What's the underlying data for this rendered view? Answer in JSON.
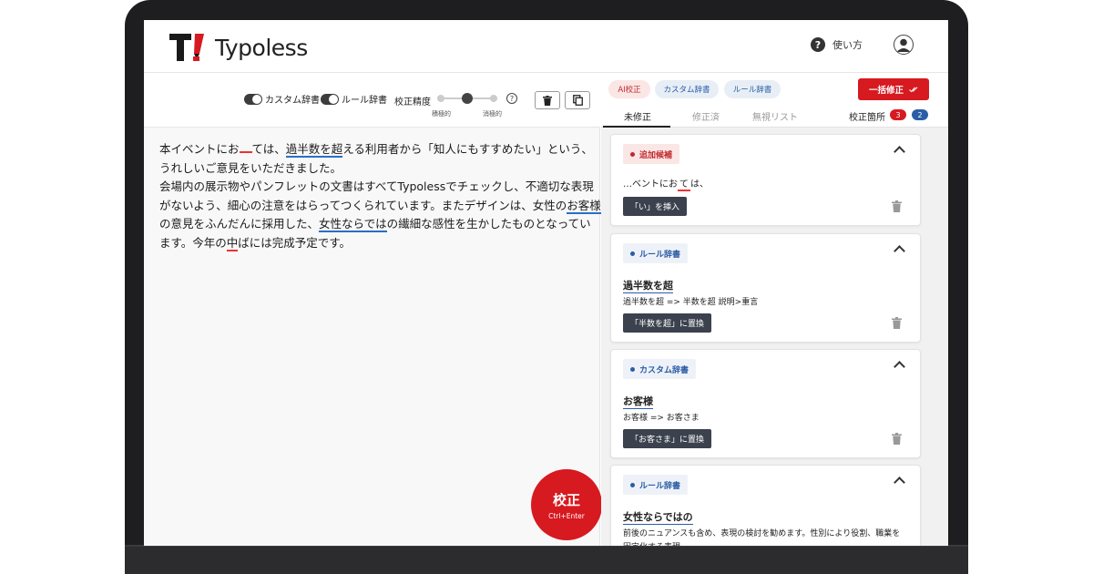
{
  "app": {
    "name": "Typoless"
  },
  "header": {
    "help_label": "使い方"
  },
  "toolbar": {
    "custom_dict_label": "カスタム辞書",
    "rule_dict_label": "ルール辞書",
    "precision_label": "校正精度",
    "precision_low": "積極的",
    "precision_high": "消極的",
    "precision_level": 2,
    "precision_steps": 3
  },
  "editor": {
    "line1_a": "本イベントにお",
    "line1_b": "ては、",
    "line1_c": "過半数を超",
    "line1_d": "える利用者から「知人にもすすめたい」という、",
    "line2": "うれしいご意見をいただきました。",
    "line3": "会場内の展示物やパンフレットの文書はすべてTypolessでチェックし、不適切な表現",
    "line4_a": "がないよう、細心の注意をはらってつくられています。またデザインは、女性の",
    "line4_b": "お客様",
    "line5_a": "の意見をふんだんに採用した、",
    "line5_b": "女性ならでは",
    "line5_c": "の繊細な感性を生かしたものとなってい",
    "line6_a": "ます。今年の",
    "line6_b": "中",
    "line6_c": "ばには完成予定です。"
  },
  "submit": {
    "label": "校正",
    "shortcut": "Ctrl+Enter"
  },
  "panel": {
    "filters": [
      "AI校正",
      "カスタム辞書",
      "ルール辞書"
    ],
    "fix_all_label": "一括修正",
    "tabs": [
      "未修正",
      "修正済",
      "無視リスト"
    ],
    "count_label": "校正箇所",
    "count_red": "3",
    "count_blue": "2"
  },
  "cards": [
    {
      "tag": "追加候補",
      "context": "…ベントにお",
      "context_gap": "て",
      "context_end": "は、",
      "button": "「い」を挿入"
    },
    {
      "tag": "ルール辞書",
      "title": "過半数を超",
      "desc": "過半数を超 => 半数を超 説明>重言",
      "button": "「半数を超」に置換"
    },
    {
      "tag": "カスタム辞書",
      "title": "お客様",
      "desc": "お客様 => お客さま",
      "button": "「お客さま」に置換"
    },
    {
      "tag": "ルール辞書",
      "title": "女性ならではの",
      "desc": "前後のニュアンスも含め、表現の検討を勧めます。性別により役割、職業を固定化する表現"
    }
  ],
  "colors": {
    "accent_red": "#d71920",
    "accent_blue": "#2a5da6",
    "dark_button": "#3b414d"
  },
  "icons": [
    "logo-icon",
    "help-icon",
    "user-icon",
    "trash-icon",
    "copy-icon",
    "chevron-up-icon",
    "check-icon",
    "question-icon"
  ]
}
